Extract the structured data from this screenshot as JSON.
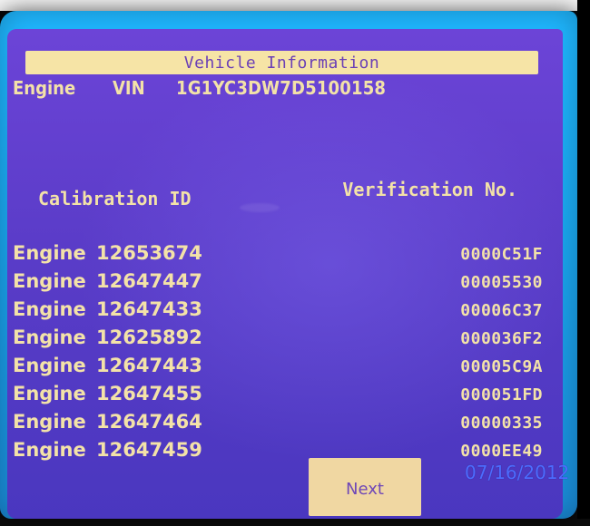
{
  "screen": {
    "title": "Vehicle Information",
    "vin": {
      "engine_label": "Engine",
      "vin_label": "VIN",
      "vin_value": "1G1YC3DW7D5100158"
    },
    "headers": {
      "calibration": "Calibration ID",
      "verification": "Verification No."
    },
    "rows": [
      {
        "engine": "Engine",
        "calibration_id": "12653674",
        "verification_no": "0000C51F"
      },
      {
        "engine": "Engine",
        "calibration_id": "12647447",
        "verification_no": "00005530"
      },
      {
        "engine": "Engine",
        "calibration_id": "12647433",
        "verification_no": "00006C37"
      },
      {
        "engine": "Engine",
        "calibration_id": "12625892",
        "verification_no": "000036F2"
      },
      {
        "engine": "Engine",
        "calibration_id": "12647443",
        "verification_no": "00005C9A"
      },
      {
        "engine": "Engine",
        "calibration_id": "12647455",
        "verification_no": "000051FD"
      },
      {
        "engine": "Engine",
        "calibration_id": "12647464",
        "verification_no": "00000335"
      },
      {
        "engine": "Engine",
        "calibration_id": "12647459",
        "verification_no": "0000EE49"
      }
    ],
    "button": {
      "next_label": "Next"
    },
    "photo_date": "07/16/2012"
  },
  "colors": {
    "bezel": "#1fb7ff",
    "screen": "#5a3cc8",
    "title_bar": "#f6e4a6",
    "text": "#f3e2a8",
    "button": "#f0d7a2",
    "date_stamp": "#4c6cff"
  }
}
